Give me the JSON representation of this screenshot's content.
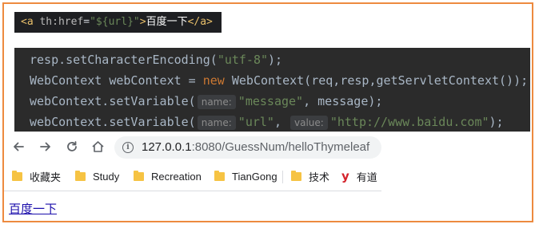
{
  "snippet_top": {
    "open_tag": "<a",
    "attr_name": "th:href",
    "eq": "=",
    "attr_value": "\"${url}\"",
    "gt": ">",
    "text": "百度一下",
    "close_tag": "</a>"
  },
  "code": {
    "line1": {
      "pre": "resp.setCharacterEncoding(",
      "str": "\"utf-8\"",
      "post": ");"
    },
    "line2": {
      "pre": "WebContext webContext = ",
      "kw": "new",
      "post": " WebContext(req,resp,getServletContext());"
    },
    "line3": {
      "pre": "webContext.setVariable(",
      "hint": "name:",
      "str": "\"message\"",
      "post": ", message);"
    },
    "line4": {
      "pre": "webContext.setVariable(",
      "hint1": "name:",
      "str1": "\"url\"",
      "comma": ",",
      "hint2": "value:",
      "str2": "\"http://www.baidu.com\"",
      "post": ");"
    }
  },
  "browser": {
    "url_host": "127.0.0.1",
    "url_path": ":8080/GuessNum/helloThymeleaf",
    "icons": [
      "back-icon",
      "forward-icon",
      "reload-icon",
      "home-icon",
      "info-icon"
    ]
  },
  "bookmarks": [
    {
      "label": "收藏夹",
      "icon": "folder-icon"
    },
    {
      "label": "Study",
      "icon": "folder-icon"
    },
    {
      "label": "Recreation",
      "icon": "folder-icon"
    },
    {
      "label": "TianGong",
      "icon": "folder-icon"
    },
    {
      "label": "技术",
      "icon": "folder-icon"
    },
    {
      "label": "有道",
      "icon": "youdao-icon"
    }
  ],
  "page": {
    "link_text": "百度一下"
  },
  "colors": {
    "frame_border": "#ed8a3f",
    "link": "#1a0dab",
    "code_bg": "#2b2b2b"
  }
}
